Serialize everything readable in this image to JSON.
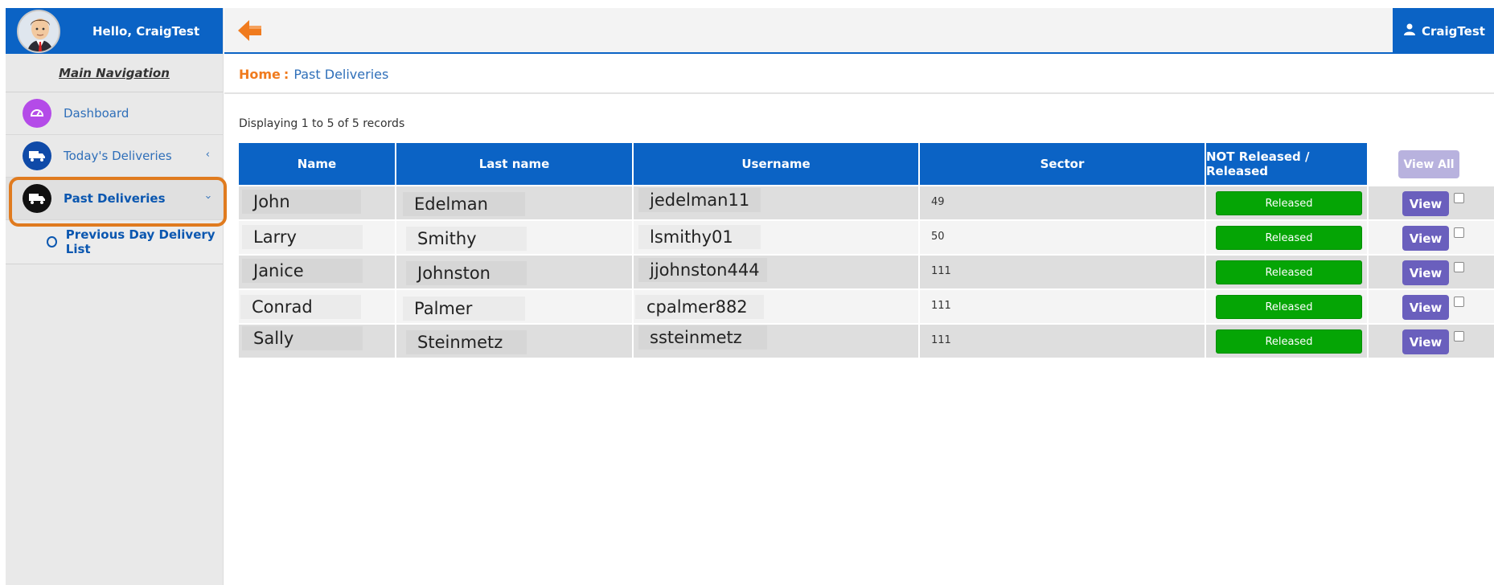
{
  "user": {
    "greeting": "Hello, CraigTest",
    "menu_label": "CraigTest",
    "avatar_icon": "user-avatar",
    "menu_icon": "person-icon"
  },
  "colors": {
    "primary": "#0b63c5",
    "accent_orange": "#f07b1e",
    "released_green": "#05a505",
    "view_purple": "#6a5fbd",
    "highlight_outline": "#e07b1f"
  },
  "sidebar": {
    "title": "Main Navigation",
    "items": [
      {
        "label": "Dashboard",
        "icon": "gauge-icon",
        "icon_color": "#b44be8",
        "active": false,
        "chevron": ""
      },
      {
        "label": "Today's Deliveries",
        "icon": "truck-icon",
        "icon_color": "#0f4aa8",
        "active": false,
        "chevron": "‹"
      },
      {
        "label": "Past Deliveries",
        "icon": "truck-icon",
        "icon_color": "#111111",
        "active": true,
        "chevron": "›"
      }
    ],
    "subitems": [
      {
        "label": "Previous Day Delivery List",
        "icon": "circle-outline-icon"
      }
    ]
  },
  "topbar": {
    "back_icon": "back-arrow-icon"
  },
  "breadcrumb": {
    "home": "Home",
    "separator": ":",
    "current": "Past Deliveries"
  },
  "records_text": "Displaying 1 to 5 of 5 records",
  "table": {
    "headers": [
      "Name",
      "Last name",
      "Username",
      "Sector",
      "NOT Released / Released"
    ],
    "view_all_label": "View All",
    "rows": [
      {
        "name": "John",
        "last_name": "Edelman",
        "username": "jedelman11",
        "sector": "49",
        "status": "Released",
        "action": "View",
        "checked": false
      },
      {
        "name": "Larry",
        "last_name": "Smithy",
        "username": "lsmithy01",
        "sector": "50",
        "status": "Released",
        "action": "View",
        "checked": false
      },
      {
        "name": "Janice",
        "last_name": "Johnston",
        "username": "jjohnston444",
        "sector": "111",
        "status": "Released",
        "action": "View",
        "checked": false
      },
      {
        "name": "Conrad",
        "last_name": "Palmer",
        "username": "cpalmer882",
        "sector": "111",
        "status": "Released",
        "action": "View",
        "checked": false
      },
      {
        "name": "Sally",
        "last_name": "Steinmetz",
        "username": "ssteinmetz",
        "sector": "111",
        "status": "Released",
        "action": "View",
        "checked": false
      }
    ]
  }
}
